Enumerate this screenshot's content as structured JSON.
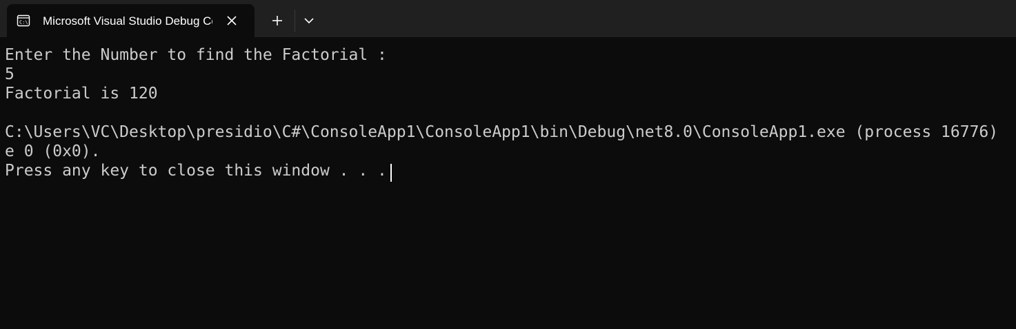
{
  "tab": {
    "title": "Microsoft Visual Studio Debug Console",
    "icon": "console-icon",
    "close_icon": "close-icon"
  },
  "toolbar": {
    "new_tab_icon": "plus-icon",
    "dropdown_icon": "chevron-down-icon"
  },
  "console": {
    "lines": [
      "Enter the Number to find the Factorial :",
      "5",
      "Factorial is 120",
      "",
      "C:\\Users\\VC\\Desktop\\presidio\\C#\\ConsoleApp1\\ConsoleApp1\\bin\\Debug\\net8.0\\ConsoleApp1.exe (process 16776)",
      "e 0 (0x0).",
      "Press any key to close this window . . ."
    ]
  },
  "colors": {
    "background": "#0c0c0c",
    "tabbar": "#202020",
    "text": "#cccccc"
  }
}
